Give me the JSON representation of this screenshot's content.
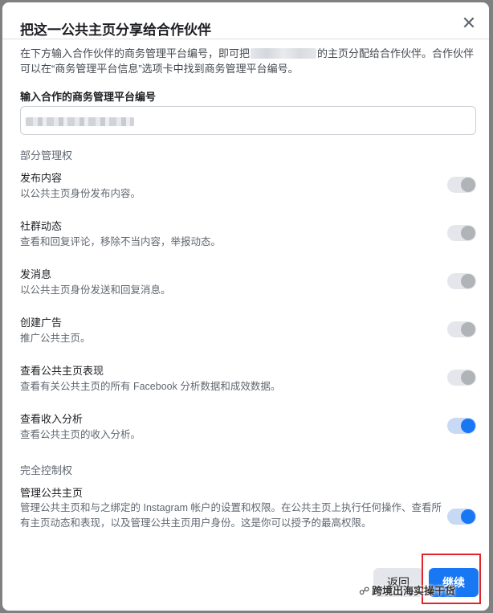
{
  "dialog": {
    "title": "把这一公共主页分享给合作伙伴",
    "intro_part1": "在下方输入合作伙伴的商务管理平台编号，即可把",
    "intro_part2": "的主页分配给合作伙伴。合作伙伴可以在“商务管理平台信息”选项卡中找到商务管理平台编号。",
    "field_label": "输入合作的商务管理平台编号",
    "partial_section": "部分管理权",
    "full_section": "完全控制权",
    "permissions": [
      {
        "title": "发布内容",
        "desc": "以公共主页身份发布内容。",
        "enabled": false
      },
      {
        "title": "社群动态",
        "desc": "查看和回复评论，移除不当内容，举报动态。",
        "enabled": false
      },
      {
        "title": "发消息",
        "desc": "以公共主页身份发送和回复消息。",
        "enabled": false
      },
      {
        "title": "创建广告",
        "desc": "推广公共主页。",
        "enabled": false
      },
      {
        "title": "查看公共主页表现",
        "desc": "查看有关公共主页的所有 Facebook 分析数据和成效数据。",
        "enabled": false
      },
      {
        "title": "查看收入分析",
        "desc": "查看公共主页的收入分析。",
        "enabled": true
      },
      {
        "title": "管理公共主页",
        "desc": "管理公共主页和与之绑定的 Instagram 帐户的设置和权限。在公共主页上执行任何操作、查看所有主页动态和表现，以及管理公共主页用户身份。这是你可以授予的最高权限。",
        "enabled": true
      }
    ],
    "back_label": "返回",
    "continue_label": "继续"
  },
  "watermark": {
    "text": "跨境出海实操干货",
    "icon": "wechat-icon"
  },
  "colors": {
    "primary": "#1877f2",
    "highlight": "#e0262b"
  }
}
